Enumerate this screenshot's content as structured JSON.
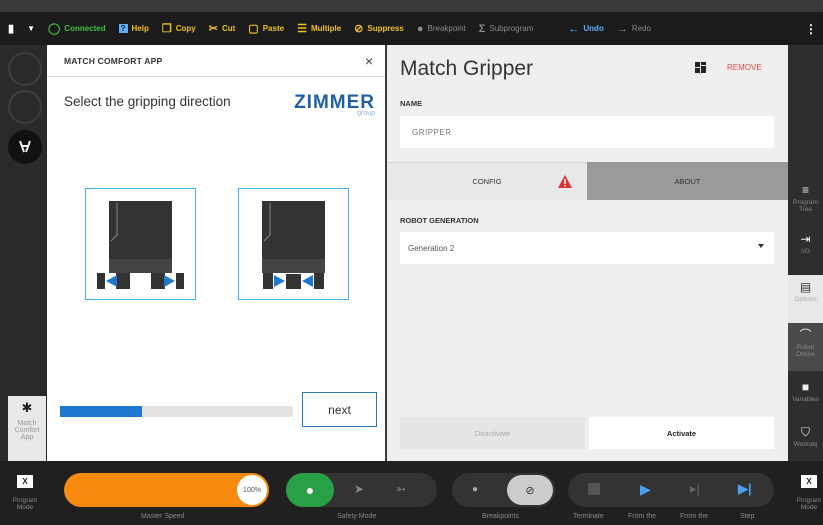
{
  "toolbar": {
    "connected": "Connected",
    "help": "Help",
    "copy": "Copy",
    "cut": "Cut",
    "paste": "Paste",
    "multiple": "Multiple",
    "suppress": "Suppress",
    "breakpoint": "Breakpoint",
    "subprogram": "Subprogram",
    "undo": "Undo",
    "redo": "Redo"
  },
  "left_rail": {
    "app_label_1": "Match",
    "app_label_2": "Comfort",
    "app_label_3": "App"
  },
  "app_panel": {
    "header": "MATCH COMFORT APP",
    "close": "×",
    "prompt": "Select the gripping direction",
    "logo_word": "ZIMMER",
    "logo_sub": "group",
    "progress": 0.35,
    "next_label": "next"
  },
  "gripper": {
    "title": "Match Gripper",
    "remove": "REMOVE",
    "name_label": "NAME",
    "name_placeholder": "GRIPPER",
    "tabs": [
      {
        "label": "CONFIG"
      },
      {
        "label": "ABOUT"
      }
    ],
    "generation_label": "ROBOT GENERATION",
    "generation_value": "Generation 2",
    "deactivate": "Deactivate",
    "activate": "Activate"
  },
  "right_rail": [
    {
      "line1": "Program",
      "line2": "Tree"
    },
    {
      "line1": "I/O",
      "line2": ""
    },
    {
      "line1": "Options",
      "line2": ""
    },
    {
      "line1": "Robot",
      "line2": "Online"
    },
    {
      "line1": "Variables",
      "line2": ""
    },
    {
      "line1": "Workobj",
      "line2": ""
    }
  ],
  "bottom": {
    "program_mode": "Program Mode",
    "program_mode_1": "Program",
    "program_mode_2": "Mode",
    "x": "X",
    "speed_value": "100%",
    "speed_fraction": 1.0,
    "master_speed": "Master Speed",
    "safety_mode": "Safety Mode",
    "breakpoints": "Breakpoints",
    "terminate": "Terminate",
    "from_the_1": "From the",
    "from_the_2": "From the",
    "step": "Step",
    "right_mode_1": "Program",
    "right_mode_2": "Mode"
  },
  "colors": {
    "accent_yellow": "#f0c020",
    "connected_green": "#3ec23e",
    "zimmer_blue": "#1f5fa8",
    "progress_blue": "#1e78d0",
    "speed_orange": "#f88a10",
    "safety_green": "#28a048",
    "warning_red": "#e03030"
  }
}
